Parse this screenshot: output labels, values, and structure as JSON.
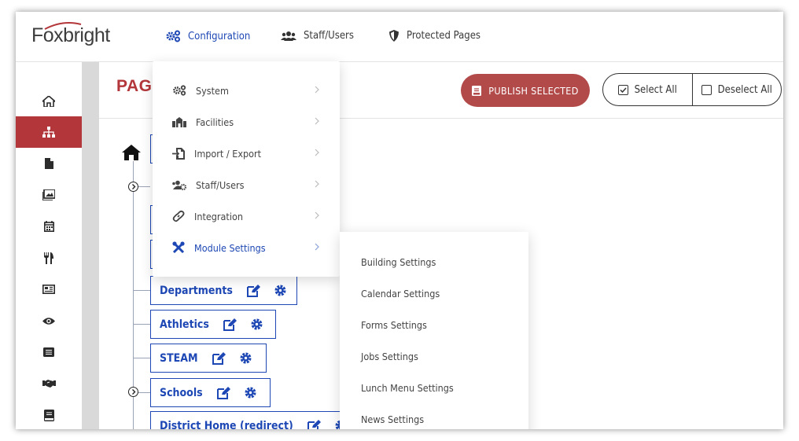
{
  "brand": {
    "logo": "Foxbright"
  },
  "topnav": [
    {
      "label": "Configuration",
      "icon": "cogs-icon"
    },
    {
      "label": "Staff/Users",
      "icon": "users-icon"
    },
    {
      "label": "Protected Pages",
      "icon": "shield-icon"
    }
  ],
  "sidebar": {
    "icons": [
      "home-icon",
      "sitemap-icon",
      "file-icon",
      "image-icon",
      "calendar-icon",
      "utensils-icon",
      "news-icon",
      "eye-icon",
      "list-icon",
      "handshake-icon",
      "book-icon"
    ]
  },
  "page": {
    "title": "PAG"
  },
  "toolbar": {
    "publish": "PUBLISH SELECTED",
    "select_all": "Select All",
    "deselect_all": "Deselect All"
  },
  "tree": {
    "nodes": [
      {
        "label": "Departments"
      },
      {
        "label": "Athletics"
      },
      {
        "label": "STEAM"
      },
      {
        "label": "Schools"
      },
      {
        "label": "District Home (redirect)"
      }
    ]
  },
  "config_menu": {
    "items": [
      {
        "label": "System",
        "icon": "cogs-icon"
      },
      {
        "label": "Facilities",
        "icon": "building-icon"
      },
      {
        "label": "Import / Export",
        "icon": "file-import-icon"
      },
      {
        "label": "Staff/Users",
        "icon": "users-cog-icon"
      },
      {
        "label": "Integration",
        "icon": "link-icon"
      },
      {
        "label": "Module Settings",
        "icon": "tools-icon"
      }
    ]
  },
  "module_submenu": {
    "items": [
      "Building Settings",
      "Calendar Settings",
      "Forms Settings",
      "Jobs Settings",
      "Lunch Menu Settings",
      "News Settings"
    ]
  },
  "colors": {
    "accent_red": "#b3363a",
    "brand_blue": "#1d47b4",
    "publish_bg": "#b34a4a"
  }
}
